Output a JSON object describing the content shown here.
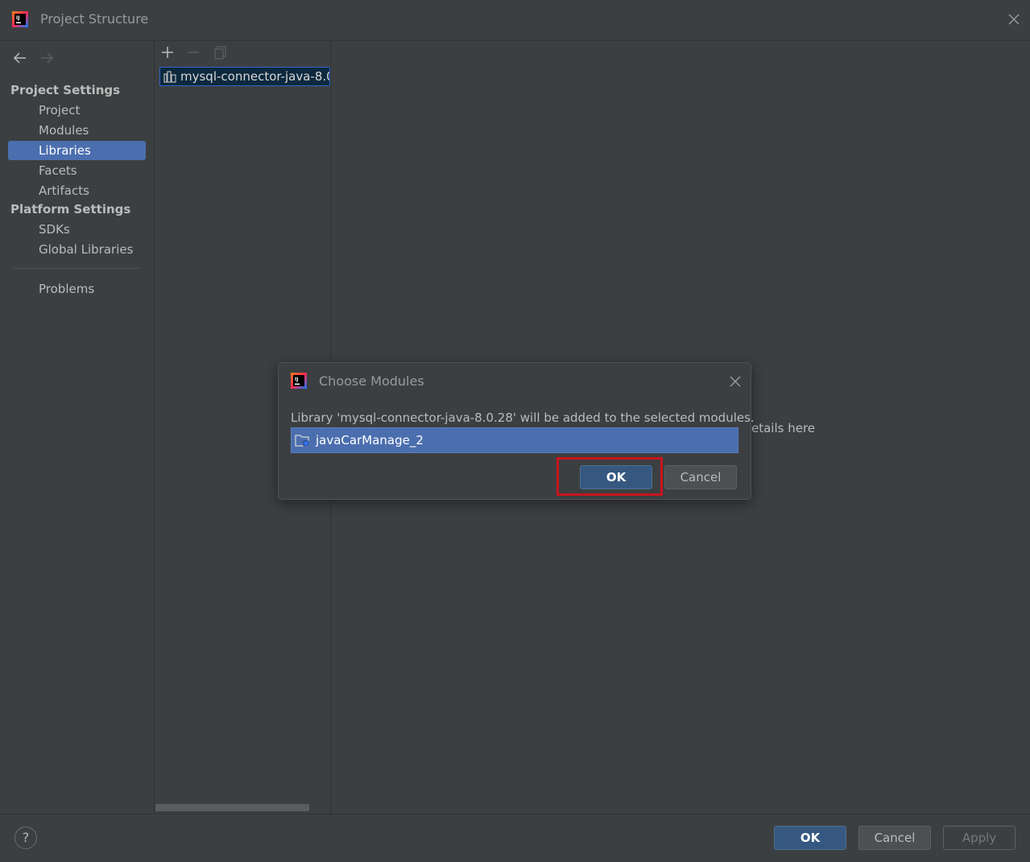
{
  "window": {
    "title": "Project Structure",
    "logo_icon": "intellij-logo-icon",
    "close_icon": "close-icon"
  },
  "sidebar": {
    "back_icon": "arrow-left-icon",
    "forward_icon": "arrow-right-icon",
    "project_settings_header": "Project Settings",
    "platform_settings_header": "Platform Settings",
    "items": [
      {
        "label": "Project",
        "selected": false
      },
      {
        "label": "Modules",
        "selected": false
      },
      {
        "label": "Libraries",
        "selected": true
      },
      {
        "label": "Facets",
        "selected": false
      },
      {
        "label": "Artifacts",
        "selected": false
      },
      {
        "label": "SDKs",
        "selected": false
      },
      {
        "label": "Global Libraries",
        "selected": false
      },
      {
        "label": "Problems",
        "selected": false
      }
    ]
  },
  "libraries": {
    "toolbar": {
      "add_icon": "plus-icon",
      "remove_icon": "minus-icon",
      "copy_icon": "copy-icon"
    },
    "items": [
      {
        "label": "mysql-connector-java-8.0",
        "icon": "library-icon"
      }
    ]
  },
  "main": {
    "details_hint": "etails here"
  },
  "footer": {
    "help_label": "?",
    "ok_label": "OK",
    "cancel_label": "Cancel",
    "apply_label": "Apply"
  },
  "dialog": {
    "title": "Choose Modules",
    "message": "Library 'mysql-connector-java-8.0.28' will be added to the selected modules.",
    "modules": [
      {
        "label": "javaCarManage_2",
        "icon": "module-folder-icon",
        "selected": true
      }
    ],
    "ok_label": "OK",
    "cancel_label": "Cancel",
    "highlight_color": "#c8141c"
  },
  "colors": {
    "background": "#3c3f41",
    "selection": "#4b6eaf",
    "default_button": "#365880",
    "highlight": "#c8141c"
  }
}
